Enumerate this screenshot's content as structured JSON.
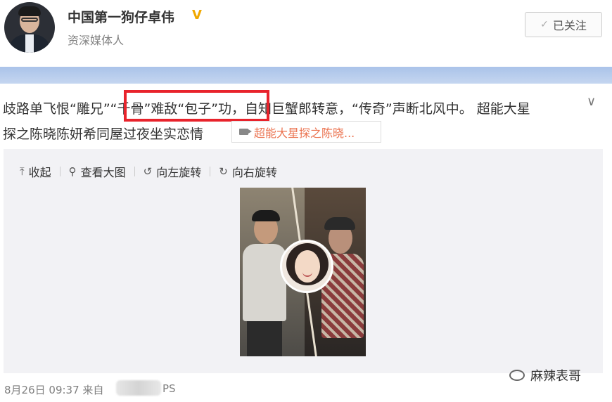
{
  "user": {
    "name": "中国第一狗仔卓伟",
    "title": "资深媒体人",
    "verified_badge": "V"
  },
  "follow_button": {
    "label": "已关注",
    "check": "✓"
  },
  "post": {
    "line1": "歧路单飞恨“雕兄”“千骨”难敌“包子”功，自知巨蟹郎转意，“传奇”声断北风中。 超能大星",
    "line2": "探之陈晓陈妍希同屋过夜坐实恋情",
    "link_chip": "超能大星探之陈晓..."
  },
  "toolbar": {
    "collapse": "收起",
    "view_large": "查看大图",
    "rotate_left": "向左旋转",
    "rotate_right": "向右旋转"
  },
  "footer": {
    "date": "8月26日 09:37 来自",
    "source_tail": "PS"
  },
  "watermark": "麻辣表哥",
  "colors": {
    "highlight": "#e8232c",
    "link": "#eb7350",
    "verified": "#f0a800",
    "banner": "#aac3e9"
  }
}
